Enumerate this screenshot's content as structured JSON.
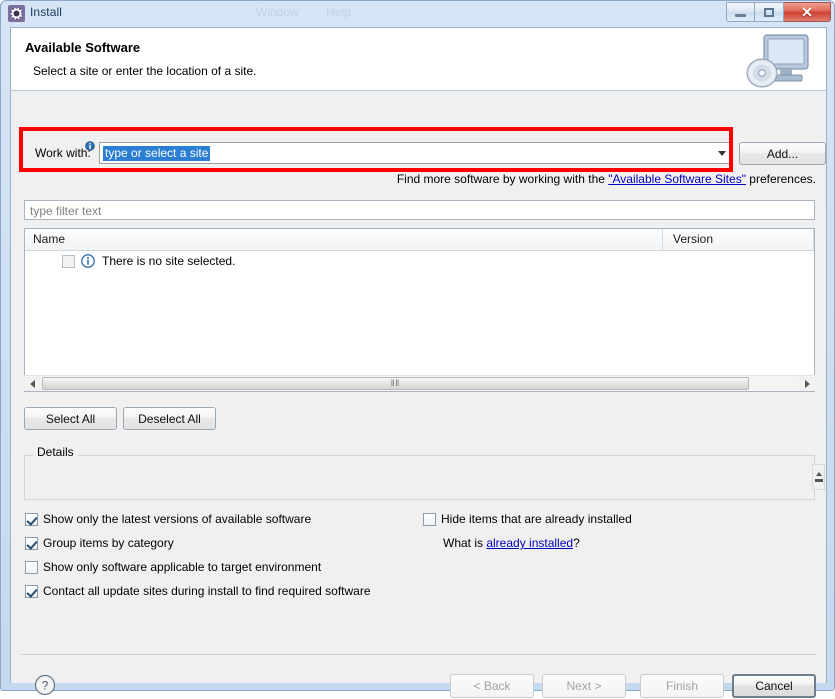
{
  "window": {
    "title": "Install",
    "icon": "eclipse-install-icon",
    "ghost_menus": [
      "Window",
      "Help"
    ],
    "controls": {
      "minimize": "minimize-button",
      "maximize": "maximize-button",
      "close": "close-button",
      "close_glyph": "✕"
    }
  },
  "banner": {
    "title": "Available Software",
    "subtitle": "Select a site or enter the location of a site.",
    "icon": "install-monitor-disc-icon"
  },
  "work_with": {
    "label": "Work with:",
    "info_icon": "info-icon",
    "combo_value": "type or select a site",
    "combo_placeholder": "type or select a site",
    "dropdown_icon": "chevron-down-icon",
    "add_label": "Add...",
    "highlight_color": "#ff0000"
  },
  "hint": {
    "prefix": "Find more software by working with the ",
    "link": "\"Available Software Sites\"",
    "suffix": " preferences."
  },
  "filter": {
    "placeholder": "type filter text",
    "value": ""
  },
  "table": {
    "columns": [
      "Name",
      "Version"
    ],
    "rows": [
      {
        "checked": false,
        "enabled": false,
        "icon": "info-icon",
        "name": "There is no site selected.",
        "version": ""
      }
    ],
    "scrollbar": {
      "left_icon": "arrow-left-icon",
      "right_icon": "arrow-right-icon",
      "grip": "‖‖"
    }
  },
  "selection_buttons": {
    "select_all": "Select All",
    "deselect_all": "Deselect All"
  },
  "details": {
    "legend": "Details",
    "content": "",
    "spinner_icon": "scroll-spinner-icon"
  },
  "options": {
    "left": [
      {
        "label": "Show only the latest versions of available software",
        "checked": true
      },
      {
        "label": "Group items by category",
        "checked": true
      },
      {
        "label": "Show only software applicable to target environment",
        "checked": false
      },
      {
        "label": "Contact all update sites during install to find required software",
        "checked": true
      }
    ],
    "right": [
      {
        "label": "Hide items that are already installed",
        "checked": false
      }
    ],
    "right_note": {
      "prefix": "What is ",
      "link": "already installed",
      "suffix": "?"
    }
  },
  "footer": {
    "help_icon": "help-question-icon",
    "buttons": [
      {
        "label": "< Back",
        "enabled": false,
        "default": false
      },
      {
        "label": "Next >",
        "enabled": false,
        "default": false
      },
      {
        "label": "Finish",
        "enabled": false,
        "default": false
      },
      {
        "label": "Cancel",
        "enabled": true,
        "default": true
      }
    ]
  }
}
